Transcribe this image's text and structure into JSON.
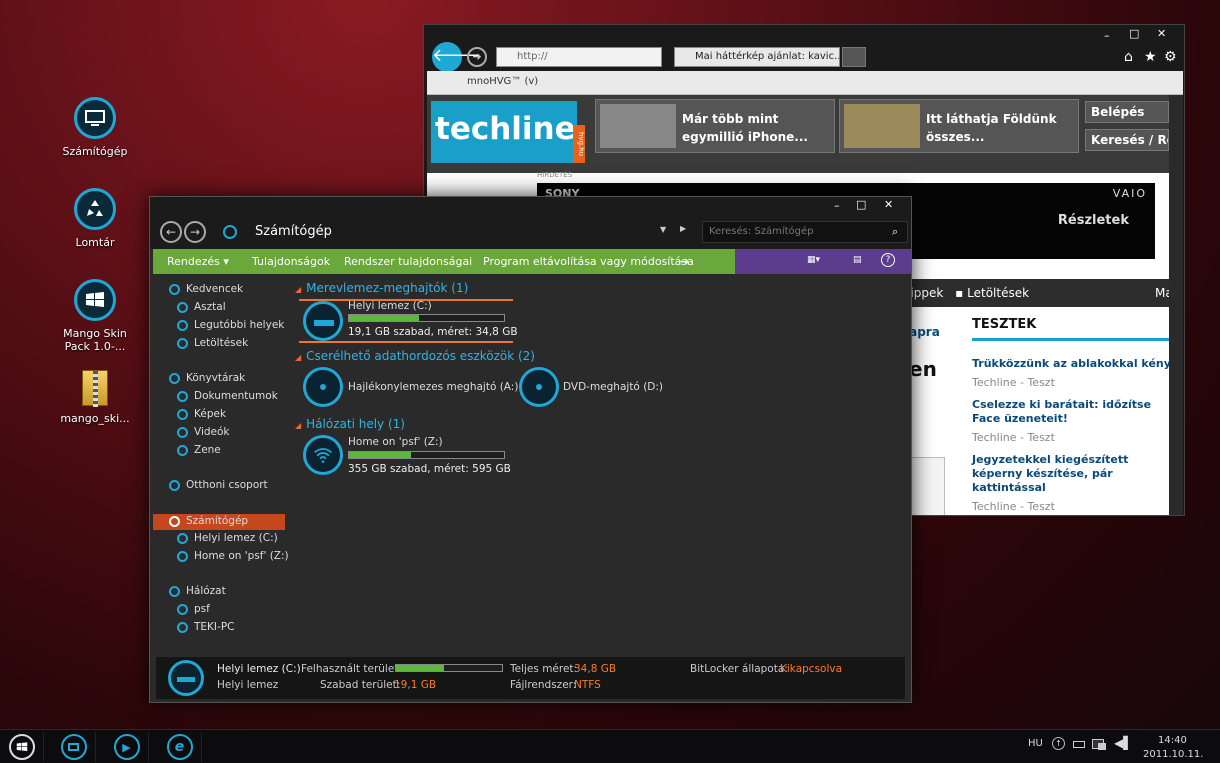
{
  "desktop": {
    "icons": [
      {
        "label": "Számítógép",
        "icon": "monitor-icon"
      },
      {
        "label": "Lomtár",
        "icon": "recycle-icon"
      },
      {
        "label": "Mango Skin Pack 1.0-...",
        "icon": "windows-flag-icon"
      },
      {
        "label": "mango_ski...",
        "icon": "zip-folder-icon"
      }
    ]
  },
  "browser": {
    "address": "http://",
    "tab_title": "Mai háttérkép ajánlat: kavic...",
    "favorites": "mnoHVG™ (v)",
    "site": {
      "logo": "techline",
      "logo_tag": "hvg.hu",
      "promo1": "Már több mint egymillió iPhone...",
      "promo2": "Itt láthatja Földünk összes...",
      "login": "Belépés",
      "search": "Keresés / Rov",
      "ad_label": "HIRDETÉS",
      "ad_brand": "SONY",
      "ad_brand2": "VAIO",
      "ad_cta": "Részletek",
      "nav": [
        "Lion tippek",
        "Letöltések",
        "Ma"
      ],
      "left_snippet1": "lapra",
      "left_snippet2": "en",
      "tests_title": "TESZTEK",
      "articles": [
        {
          "title": "Trükközzünk az ablakokkal kényel",
          "meta": "Techline - Teszt"
        },
        {
          "title": "Cselezze ki barátait: időzítse Face üzeneteit!",
          "meta": "Techline - Teszt"
        },
        {
          "title": "Jegyzetekkel kiegészített képerny készítése, pár kattintással",
          "meta": "Techline - Teszt"
        }
      ]
    }
  },
  "explorer": {
    "title": "Számítógép",
    "search_placeholder": "Keresés: Számítógép",
    "commands": [
      "Rendezés ▾",
      "Tulajdonságok",
      "Rendszer tulajdonságai",
      "Program eltávolítása vagy módosítása"
    ],
    "nav": {
      "favorites": "Kedvencek",
      "fav_items": [
        "Asztal",
        "Legutóbbi helyek",
        "Letöltések"
      ],
      "libraries": "Könyvtárak",
      "lib_items": [
        "Dokumentumok",
        "Képek",
        "Videók",
        "Zene"
      ],
      "homegroup": "Otthoni csoport",
      "computer": "Számítógép",
      "comp_items": [
        "Helyi lemez (C:)",
        "Home on 'psf' (Z:)"
      ],
      "network": "Hálózat",
      "net_items": [
        "psf",
        "TEKI-PC"
      ]
    },
    "groups": {
      "hdd": "Merevlemez-meghajtók (1)",
      "removable": "Cserélhető adathordozós eszközök (2)",
      "network": "Hálózati hely (1)"
    },
    "drives": {
      "c": {
        "name": "Helyi lemez (C:)",
        "free": "19,1 GB szabad, méret: 34,8 GB",
        "used_fraction": 0.45
      },
      "a": {
        "name": "Hajlékonylemezes meghajtó (A:)"
      },
      "d": {
        "name": "DVD-meghajtó (D:)"
      },
      "z": {
        "name": "Home on 'psf' (Z:)",
        "free": "355 GB szabad, méret: 595 GB",
        "used_fraction": 0.4
      }
    },
    "status": {
      "name": "Helyi lemez (C:)",
      "type": "Helyi lemez",
      "used_label": "Felhasznált terület:",
      "free_label": "Szabad terület:",
      "free_value": "19,1 GB",
      "total_label": "Teljes méret:",
      "total_value": "34,8 GB",
      "fs_label": "Fájlrendszer:",
      "fs_value": "NTFS",
      "bitlocker_label": "BitLocker állapota:",
      "bitlocker_value": "Kikapcsolva"
    }
  },
  "taskbar": {
    "lang": "HU",
    "time": "14:40",
    "date": "2011.10.11."
  }
}
